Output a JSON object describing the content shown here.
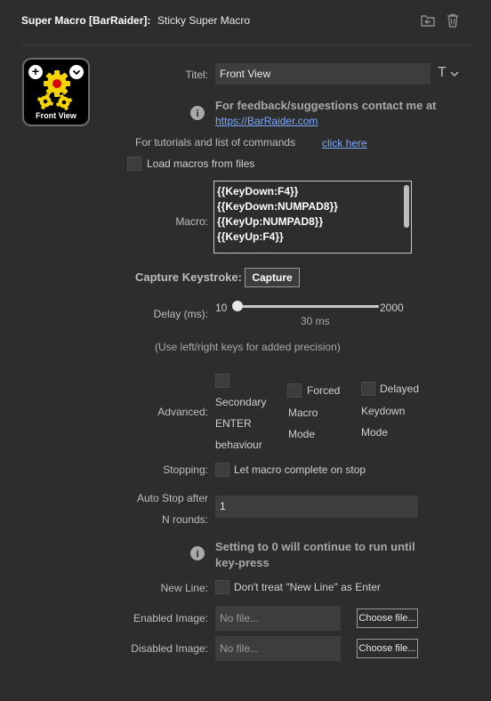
{
  "header": {
    "plugin": "Super Macro [BarRaider]:",
    "action": "Sticky Super Macro"
  },
  "key": {
    "title": "Front View",
    "plus": "+"
  },
  "title_field": {
    "label": "Titel:",
    "value": "Front View",
    "format_glyph": "T"
  },
  "feedback": {
    "text": "For feedback/suggestions contact me at",
    "link": "https://BarRaider.com"
  },
  "tutorials": {
    "text": "For tutorials and list of commands",
    "link": "click here"
  },
  "load_macros": {
    "label": "Load macros from files"
  },
  "macro": {
    "label": "Macro:",
    "lines": [
      "{{KeyDown:F4}}",
      "{{KeyDown:NUMPAD8}}",
      "{{KeyUp:NUMPAD8}}",
      "{{KeyUp:F4}}"
    ]
  },
  "capture": {
    "label": "Capture Keystroke:",
    "button": "Capture"
  },
  "delay": {
    "label": "Delay (ms):",
    "min": "10",
    "max": "2000",
    "value_text": "30 ms",
    "value": 30,
    "hint": "(Use left/right keys for added precision)"
  },
  "advanced": {
    "label": "Advanced:",
    "options": [
      {
        "lines": [
          "Secondary",
          "ENTER",
          "behaviour"
        ]
      },
      {
        "lines": [
          "Forced",
          "Macro",
          "Mode"
        ]
      },
      {
        "lines": [
          "Delayed",
          "Keydown",
          "Mode"
        ]
      }
    ]
  },
  "stopping": {
    "label": "Stopping:",
    "option": "Let macro complete on stop"
  },
  "auto_stop": {
    "label_line1": "Auto Stop after",
    "label_line2": "N rounds:",
    "value": "1"
  },
  "auto_stop_info": {
    "line1": "Setting to 0 will continue to run until",
    "line2": "key-press"
  },
  "new_line": {
    "label": "New Line:",
    "option": "Don't treat \"New Line\" as Enter"
  },
  "enabled_image": {
    "label": "Enabled Image:",
    "placeholder": "No file...",
    "button": "Choose file..."
  },
  "disabled_image": {
    "label": "Disabled Image:",
    "placeholder": "No file...",
    "button": "Choose file..."
  },
  "icons": {
    "back": "back-arrow-icon",
    "delete": "trash-icon",
    "info": "info-icon",
    "format": "text-format-icon",
    "gears": "gears-icon"
  }
}
